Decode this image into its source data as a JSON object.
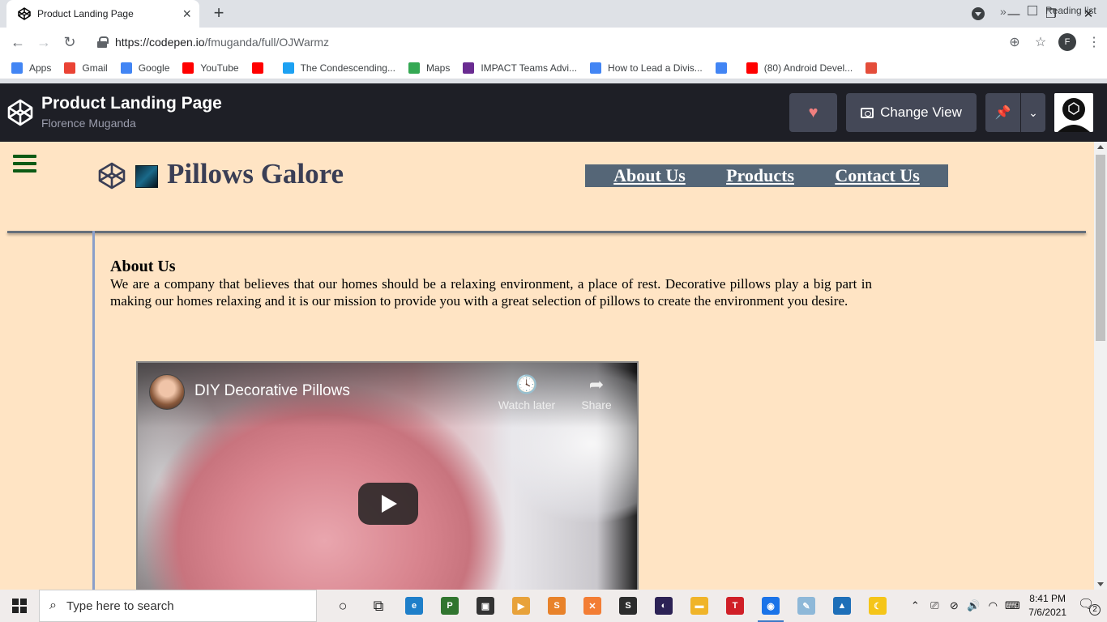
{
  "browser": {
    "tab": {
      "title": "Product Landing Page"
    },
    "url": {
      "host": "https://codepen.io",
      "path": "/fmuganda/full/OJWarmz"
    },
    "profile_initial": "F",
    "bookmarks": [
      {
        "label": "Apps",
        "icon": "apps-grid-icon",
        "color": "#4285f4"
      },
      {
        "label": "Gmail",
        "icon": "gmail-icon",
        "color": "#ea4335"
      },
      {
        "label": "Google",
        "icon": "google-icon",
        "color": "#4285f4"
      },
      {
        "label": "YouTube",
        "icon": "youtube-icon",
        "color": "#ff0000"
      },
      {
        "label": "",
        "icon": "youtube-icon",
        "color": "#ff0000"
      },
      {
        "label": "The Condescending...",
        "icon": "tw-icon",
        "color": "#1da1f2"
      },
      {
        "label": "Maps",
        "icon": "maps-pin-icon",
        "color": "#34a853"
      },
      {
        "label": "IMPACT Teams Advi...",
        "icon": "impact-icon",
        "color": "#6a2c91"
      },
      {
        "label": "How to Lead a Divis...",
        "icon": "google-icon",
        "color": "#4285f4"
      },
      {
        "label": "",
        "icon": "google-icon",
        "color": "#4285f4"
      },
      {
        "label": "(80) Android Devel...",
        "icon": "youtube-icon",
        "color": "#ff0000"
      },
      {
        "label": "",
        "icon": "r-icon",
        "color": "#e44d3a"
      }
    ],
    "reading_list": "Reading list"
  },
  "codepen": {
    "title": "Product Landing Page",
    "author": "Florence Muganda",
    "change_view": "Change View"
  },
  "site": {
    "title": "Pillows Galore",
    "nav": [
      "About Us",
      "Products",
      "Contact Us"
    ],
    "about": {
      "heading": "About Us",
      "text": "We are a company that believes that our homes should be a relaxing environment, a place of rest. Decorative pillows play a big part in making our homes relaxing and it is our mission to provide you with a great selection of pillows to create the environment you desire."
    },
    "video": {
      "title": "DIY Decorative Pillows",
      "watch_later": "Watch later",
      "share": "Share"
    }
  },
  "taskbar": {
    "search_placeholder": "Type here to search",
    "time": "8:41 PM",
    "date": "7/6/2021",
    "notification_count": "2",
    "apps": [
      {
        "icon": "cortana-icon",
        "color": "#222222",
        "glyph": "○"
      },
      {
        "icon": "task-view-icon",
        "color": "#222222",
        "glyph": "⧉"
      },
      {
        "icon": "edge-icon",
        "color": "#1f7fc9",
        "glyph": "e"
      },
      {
        "icon": "project-icon",
        "color": "#31752f",
        "glyph": "P"
      },
      {
        "icon": "store-icon",
        "color": "#333333",
        "glyph": "▣"
      },
      {
        "icon": "media-player-icon",
        "color": "#e8a23a",
        "glyph": "▶"
      },
      {
        "icon": "sublime-s-icon",
        "color": "#e8822a",
        "glyph": "S"
      },
      {
        "icon": "xampp-icon",
        "color": "#f37d34",
        "glyph": "✕"
      },
      {
        "icon": "sublime-text-icon",
        "color": "#2c2c2c",
        "glyph": "S"
      },
      {
        "icon": "eclipse-icon",
        "color": "#2c2255",
        "glyph": "◐"
      },
      {
        "icon": "file-explorer-icon",
        "color": "#f0b429",
        "glyph": "▬"
      },
      {
        "icon": "typing-t-icon",
        "color": "#d01f27",
        "glyph": "T"
      },
      {
        "icon": "chrome-icon",
        "color": "#1a73e8",
        "glyph": "◉"
      },
      {
        "icon": "paint-icon",
        "color": "#8eb8d8",
        "glyph": "✎"
      },
      {
        "icon": "photos-icon",
        "color": "#1e6fb8",
        "glyph": "▲"
      },
      {
        "icon": "night-light-icon",
        "color": "#f5c518",
        "glyph": "☾"
      }
    ]
  }
}
